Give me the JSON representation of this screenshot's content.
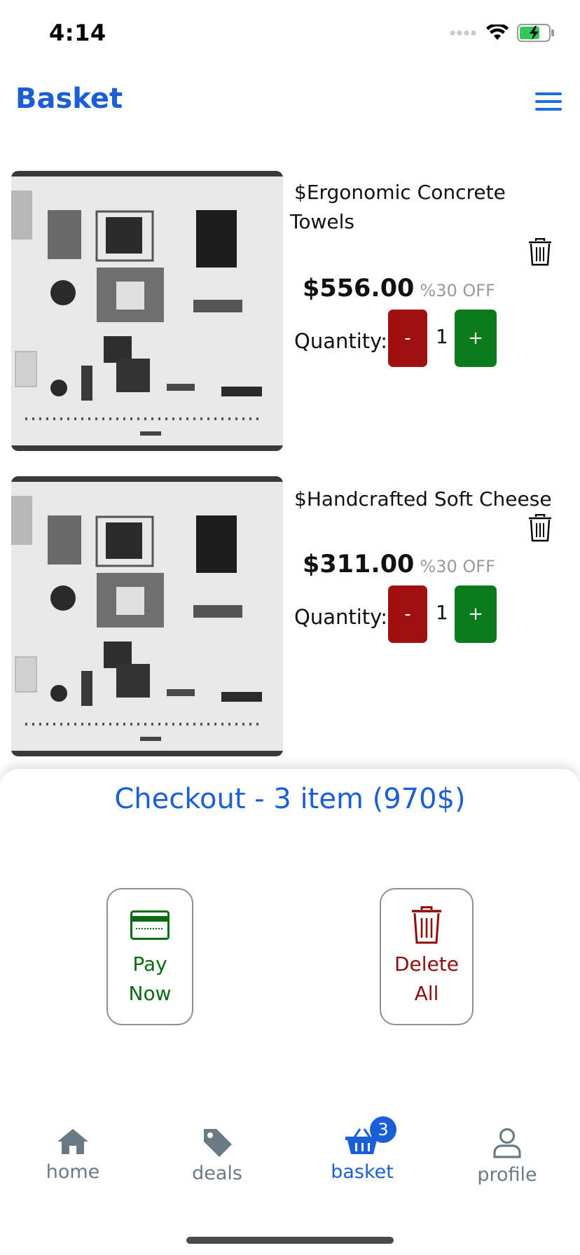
{
  "status_bar": {
    "time": "4:14"
  },
  "header": {
    "title": "Basket"
  },
  "items": [
    {
      "name": "$Ergonomic Concrete Towels",
      "name_line1": "$Ergonomic Concrete",
      "name_line2": "Towels",
      "price": "$556.00",
      "discount": "%30 OFF",
      "quantity_label": "Quantity:",
      "quantity": "1",
      "minus_label": "-",
      "plus_label": "+"
    },
    {
      "name": "$Handcrafted Soft Cheese",
      "price": "$311.00",
      "discount": "%30 OFF",
      "quantity_label": "Quantity:",
      "quantity": "1",
      "minus_label": "-",
      "plus_label": "+"
    }
  ],
  "checkout": {
    "title": "Checkout - 3 item (970$)",
    "pay_line1": "Pay",
    "pay_line2": "Now",
    "delete_line1": "Delete",
    "delete_line2": "All"
  },
  "nav": {
    "items": [
      {
        "label": "home",
        "icon": "home-icon"
      },
      {
        "label": "deals",
        "icon": "tag-icon"
      },
      {
        "label": "basket",
        "icon": "basket-icon",
        "badge": "3",
        "active": true
      },
      {
        "label": "profile",
        "icon": "profile-icon"
      }
    ]
  },
  "colors": {
    "accent": "#1a5fd6",
    "minus": "#a01010",
    "plus": "#0b7a1a",
    "pay": "#0b6b12",
    "delete": "#8e0d0d",
    "nav_inactive": "#6b7b86"
  }
}
